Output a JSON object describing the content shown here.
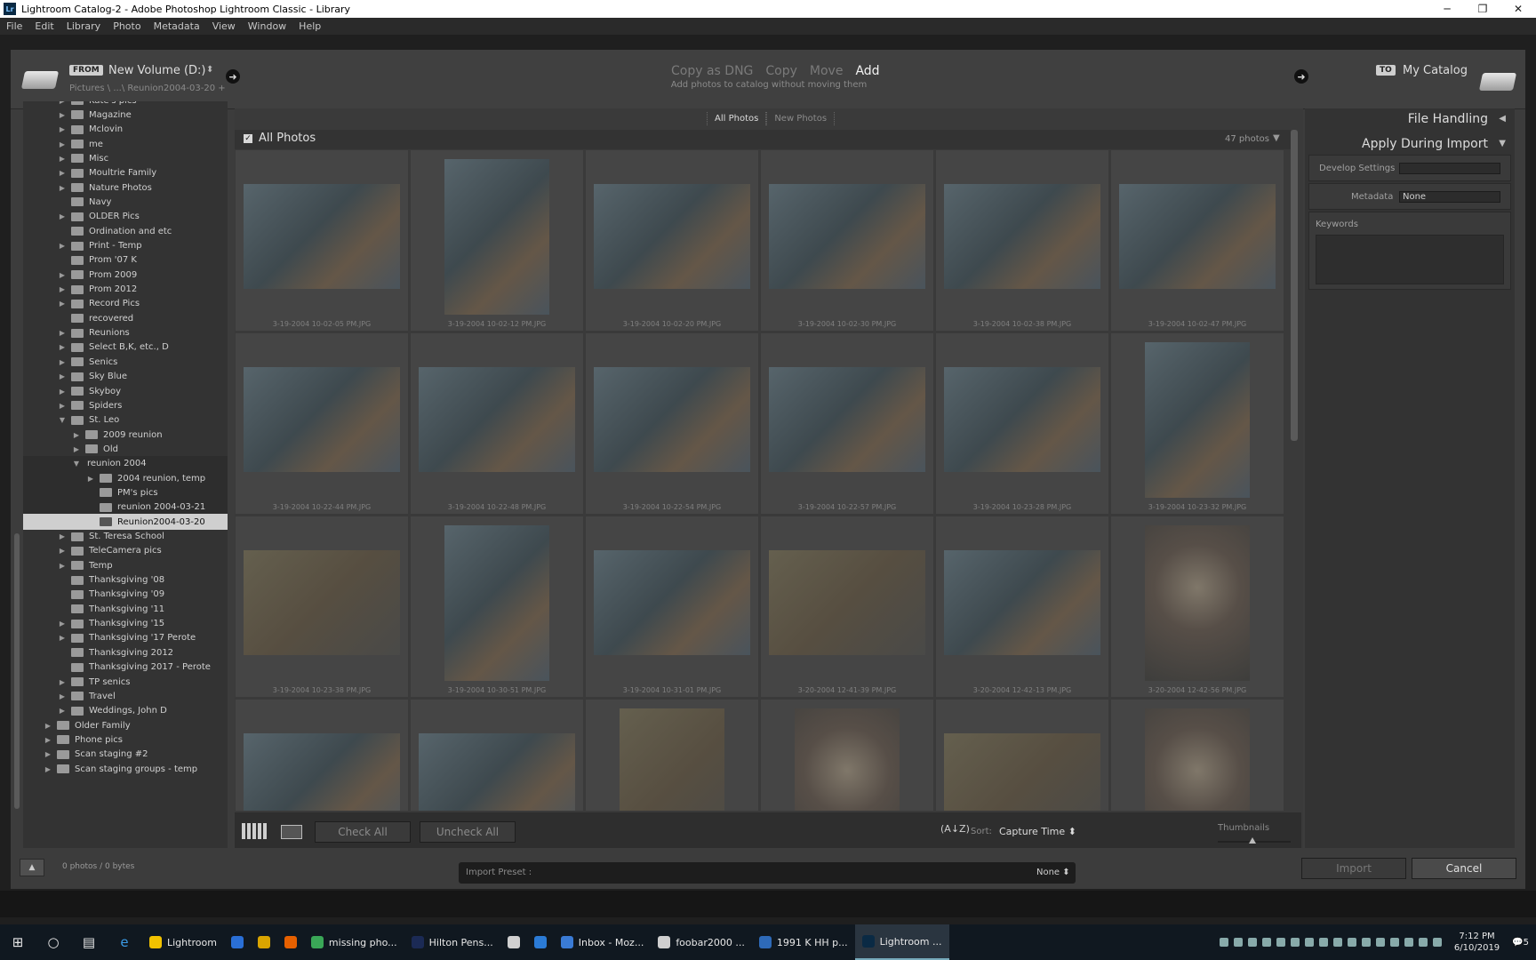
{
  "window": {
    "title": "Lightroom Catalog-2 - Adobe Photoshop Lightroom Classic - Library",
    "controls": [
      "─",
      "❐",
      "✕"
    ]
  },
  "menu": [
    "File",
    "Edit",
    "Library",
    "Photo",
    "Metadata",
    "View",
    "Window",
    "Help"
  ],
  "source": {
    "badge": "FROM",
    "name": "New Volume (D:)",
    "path": "Pictures \\ ...\\ Reunion2004-03-20 +"
  },
  "modes": {
    "items": [
      "Copy as DNG",
      "Copy",
      "Move",
      "Add"
    ],
    "active": "Add",
    "description": "Add photos to catalog without moving them"
  },
  "destination": {
    "badge": "TO",
    "name": "My Catalog"
  },
  "folders": [
    {
      "name": "Kate's pics",
      "indent": 1,
      "tri": "▶"
    },
    {
      "name": "Magazine",
      "indent": 1,
      "tri": "▶"
    },
    {
      "name": "Mclovin",
      "indent": 1,
      "tri": "▶"
    },
    {
      "name": "me",
      "indent": 1,
      "tri": "▶"
    },
    {
      "name": "Misc",
      "indent": 1,
      "tri": "▶"
    },
    {
      "name": "Moultrie Family",
      "indent": 1,
      "tri": "▶"
    },
    {
      "name": "Nature Photos",
      "indent": 1,
      "tri": "▶"
    },
    {
      "name": "Navy",
      "indent": 1,
      "tri": ""
    },
    {
      "name": "OLDER Pics",
      "indent": 1,
      "tri": "▶"
    },
    {
      "name": "Ordination and etc",
      "indent": 1,
      "tri": ""
    },
    {
      "name": "Print - Temp",
      "indent": 1,
      "tri": "▶"
    },
    {
      "name": "Prom '07 K",
      "indent": 1,
      "tri": ""
    },
    {
      "name": "Prom 2009",
      "indent": 1,
      "tri": "▶"
    },
    {
      "name": "Prom 2012",
      "indent": 1,
      "tri": "▶"
    },
    {
      "name": "Record Pics",
      "indent": 1,
      "tri": "▶"
    },
    {
      "name": "recovered",
      "indent": 1,
      "tri": ""
    },
    {
      "name": "Reunions",
      "indent": 1,
      "tri": "▶"
    },
    {
      "name": "Select B,K, etc., D",
      "indent": 1,
      "tri": "▶"
    },
    {
      "name": "Senics",
      "indent": 1,
      "tri": "▶"
    },
    {
      "name": "Sky Blue",
      "indent": 1,
      "tri": "▶"
    },
    {
      "name": "Skyboy",
      "indent": 1,
      "tri": "▶"
    },
    {
      "name": "Spiders",
      "indent": 1,
      "tri": "▶"
    },
    {
      "name": "St. Leo",
      "indent": 1,
      "tri": "▼"
    },
    {
      "name": "2009 reunion",
      "indent": 2,
      "tri": "▶"
    },
    {
      "name": "Old",
      "indent": 2,
      "tri": "▶"
    },
    {
      "name": "reunion 2004",
      "indent": 2,
      "tri": "▼",
      "nofolder": true,
      "sub": true
    },
    {
      "name": "2004 reunion, temp",
      "indent": 3,
      "tri": "▶",
      "sub": true
    },
    {
      "name": "PM's pics",
      "indent": 3,
      "tri": "",
      "sub": true
    },
    {
      "name": "reunion 2004-03-21",
      "indent": 3,
      "tri": "",
      "sub": true
    },
    {
      "name": "Reunion2004-03-20",
      "indent": 3,
      "tri": "",
      "sel": true
    },
    {
      "name": "St. Teresa School",
      "indent": 1,
      "tri": "▶"
    },
    {
      "name": "TeleCamera pics",
      "indent": 1,
      "tri": "▶"
    },
    {
      "name": "Temp",
      "indent": 1,
      "tri": "▶"
    },
    {
      "name": "Thanksgiving '08",
      "indent": 1,
      "tri": ""
    },
    {
      "name": "Thanksgiving '09",
      "indent": 1,
      "tri": ""
    },
    {
      "name": "Thanksgiving '11",
      "indent": 1,
      "tri": ""
    },
    {
      "name": "Thanksgiving '15",
      "indent": 1,
      "tri": "▶"
    },
    {
      "name": "Thanksgiving '17 Perote",
      "indent": 1,
      "tri": "▶"
    },
    {
      "name": "Thanksgiving 2012",
      "indent": 1,
      "tri": ""
    },
    {
      "name": "Thanksgiving 2017 - Perote",
      "indent": 1,
      "tri": ""
    },
    {
      "name": "TP senics",
      "indent": 1,
      "tri": "▶"
    },
    {
      "name": "Travel",
      "indent": 1,
      "tri": "▶"
    },
    {
      "name": "Weddings, John D",
      "indent": 1,
      "tri": "▶"
    },
    {
      "name": "Older Family",
      "indent": 0,
      "tri": "▶"
    },
    {
      "name": "Phone pics",
      "indent": 0,
      "tri": "▶"
    },
    {
      "name": "Scan staging #2",
      "indent": 0,
      "tri": "▶"
    },
    {
      "name": "Scan staging groups - temp",
      "indent": 0,
      "tri": "▶"
    }
  ],
  "left_footer": {
    "count": "0 photos / 0 bytes"
  },
  "tabs": [
    "All Photos",
    "New Photos"
  ],
  "grid_header": {
    "label": "All Photos",
    "count": "47 photos"
  },
  "photos": [
    {
      "file": "3-19-2004 10-02-05 PM.JPG",
      "orient": "land",
      "tone": "cool"
    },
    {
      "file": "3-19-2004 10-02-12 PM.JPG",
      "orient": "port",
      "tone": "cool"
    },
    {
      "file": "3-19-2004 10-02-20 PM.JPG",
      "orient": "land",
      "tone": "cool"
    },
    {
      "file": "3-19-2004 10-02-30 PM.JPG",
      "orient": "land",
      "tone": "cool"
    },
    {
      "file": "3-19-2004 10-02-38 PM.JPG",
      "orient": "land",
      "tone": "cool"
    },
    {
      "file": "3-19-2004 10-02-47 PM.JPG",
      "orient": "land",
      "tone": "cool"
    },
    {
      "file": "3-19-2004 10-22-44 PM.JPG",
      "orient": "land",
      "tone": "cool"
    },
    {
      "file": "3-19-2004 10-22-48 PM.JPG",
      "orient": "land",
      "tone": "cool"
    },
    {
      "file": "3-19-2004 10-22-54 PM.JPG",
      "orient": "land",
      "tone": "cool"
    },
    {
      "file": "3-19-2004 10-22-57 PM.JPG",
      "orient": "land",
      "tone": "cool"
    },
    {
      "file": "3-19-2004 10-23-28 PM.JPG",
      "orient": "land",
      "tone": "cool"
    },
    {
      "file": "3-19-2004 10-23-32 PM.JPG",
      "orient": "port",
      "tone": "cool"
    },
    {
      "file": "3-19-2004 10-23-38 PM.JPG",
      "orient": "land",
      "tone": "warm"
    },
    {
      "file": "3-19-2004 10-30-51 PM.JPG",
      "orient": "port",
      "tone": "cool"
    },
    {
      "file": "3-19-2004 10-31-01 PM.JPG",
      "orient": "land",
      "tone": "cool"
    },
    {
      "file": "3-20-2004 12-41-39 PM.JPG",
      "orient": "land",
      "tone": "warm"
    },
    {
      "file": "3-20-2004 12-42-13 PM.JPG",
      "orient": "land",
      "tone": "cool"
    },
    {
      "file": "3-20-2004 12-42-56 PM.JPG",
      "orient": "port",
      "tone": "face"
    },
    {
      "file": "",
      "orient": "land",
      "tone": "cool"
    },
    {
      "file": "",
      "orient": "land",
      "tone": "cool"
    },
    {
      "file": "",
      "orient": "port",
      "tone": "warm"
    },
    {
      "file": "",
      "orient": "port",
      "tone": "face"
    },
    {
      "file": "",
      "orient": "land",
      "tone": "warm"
    },
    {
      "file": "",
      "orient": "port",
      "tone": "face"
    }
  ],
  "toolbar": {
    "check_all": "Check All",
    "uncheck_all": "Uncheck All",
    "sort_label": "Sort:",
    "sort_value": "Capture Time ⬍",
    "az": "(A↓Z)",
    "thumbnails": "Thumbnails",
    "thumb_level": 0.48
  },
  "right": {
    "file_handling": "File Handling",
    "apply": "Apply During Import",
    "develop_label": "Develop Settings",
    "develop_value": "",
    "metadata_label": "Metadata",
    "metadata_value": "None",
    "keywords_label": "Keywords"
  },
  "footer": {
    "preset_label": "Import Preset :",
    "preset_value": "None ⬍",
    "import": "Import",
    "cancel": "Cancel"
  },
  "taskbar": {
    "apps": [
      {
        "label": "Lightroom",
        "color": "#f2c200"
      },
      {
        "label": "",
        "color": "#2a6fd6"
      },
      {
        "label": "",
        "color": "#d9a400"
      },
      {
        "label": "",
        "color": "#e66000"
      },
      {
        "label": "missing pho...",
        "color": "#3aa757"
      },
      {
        "label": "Hilton Pens...",
        "color": "#1b2a55"
      },
      {
        "label": "",
        "color": "#d0d0d0"
      },
      {
        "label": "",
        "color": "#2b7bd6"
      },
      {
        "label": "Inbox - Moz...",
        "color": "#3a7bd5"
      },
      {
        "label": "foobar2000 ...",
        "color": "#cfcfcf"
      },
      {
        "label": "1991 K HH p...",
        "color": "#2e6ab8"
      },
      {
        "label": "Lightroom ...",
        "color": "#0a2a44",
        "active": true
      }
    ],
    "time": "7:12 PM",
    "date": "6/10/2019",
    "notif": "5"
  }
}
